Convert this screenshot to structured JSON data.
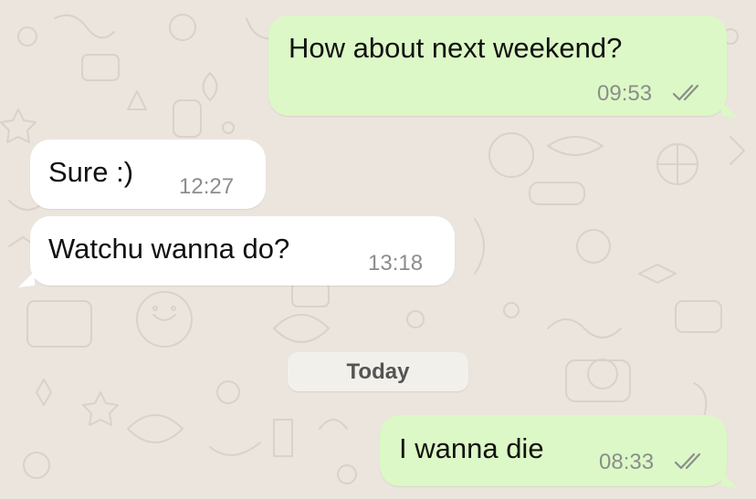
{
  "colors": {
    "background": "#ebe5dd",
    "outgoing_bubble": "#dcf8c6",
    "incoming_bubble": "#ffffff",
    "timestamp": "#8a8e8a",
    "read_ticks": "#8a8e8a"
  },
  "messages": [
    {
      "direction": "outgoing",
      "text": "How about next weekend?",
      "time": "09:53",
      "status_icon": "double-check-icon"
    },
    {
      "direction": "incoming",
      "text": "Sure :)",
      "time": "12:27"
    },
    {
      "direction": "incoming",
      "text": "Watchu wanna do?",
      "time": "13:18"
    },
    {
      "direction": "outgoing",
      "text": "I wanna die",
      "time": "08:33",
      "status_icon": "double-check-icon"
    }
  ],
  "date_separator": {
    "label": "Today"
  }
}
